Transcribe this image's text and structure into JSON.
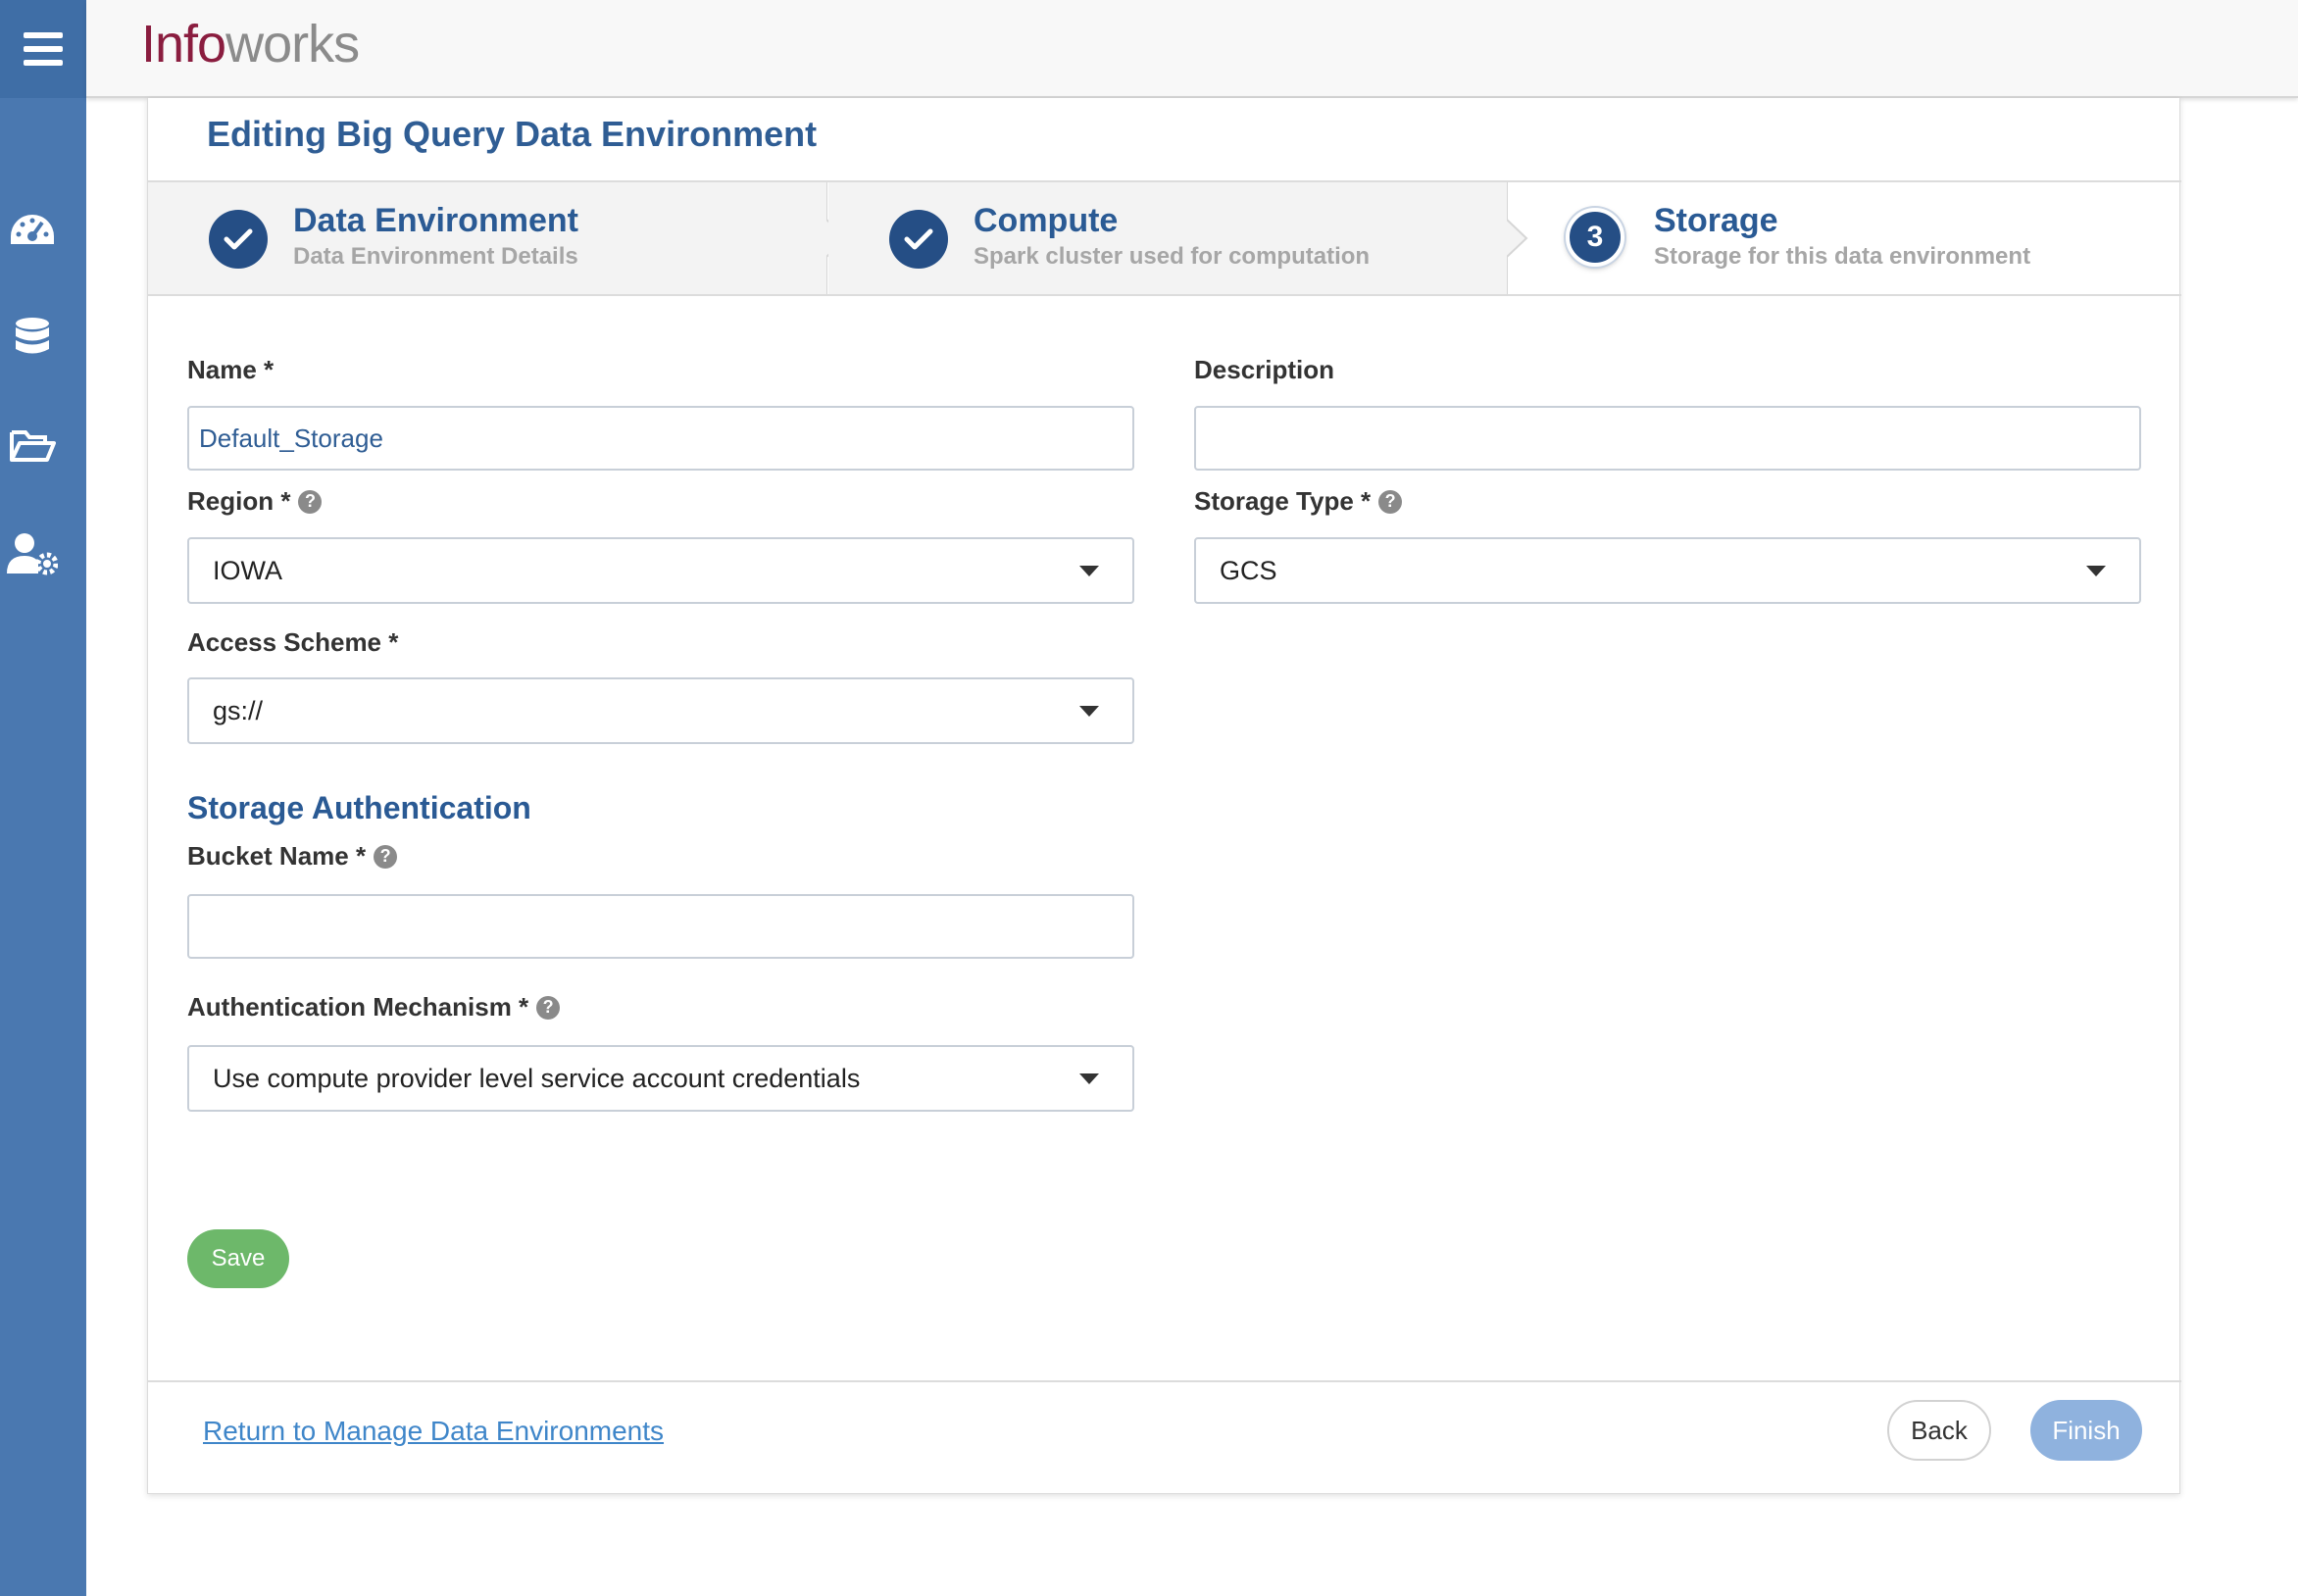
{
  "app": {
    "logo_part1": "Info",
    "logo_part2": "works"
  },
  "sidebar": {
    "items": [
      {
        "icon": "dashboard-icon"
      },
      {
        "icon": "database-icon"
      },
      {
        "icon": "folder-icon"
      },
      {
        "icon": "user-settings-icon"
      }
    ]
  },
  "page": {
    "title": "Editing Big Query Data Environment"
  },
  "steps": [
    {
      "title": "Data Environment",
      "subtitle": "Data Environment Details",
      "state": "done"
    },
    {
      "title": "Compute",
      "subtitle": "Spark cluster used for computation",
      "state": "done"
    },
    {
      "number": "3",
      "title": "Storage",
      "subtitle": "Storage for this data environment",
      "state": "active"
    }
  ],
  "form": {
    "name_label": "Name *",
    "name_value": "Default_Storage",
    "description_label": "Description",
    "description_value": "",
    "region_label": "Region *",
    "region_value": "IOWA",
    "storage_type_label": "Storage Type *",
    "storage_type_value": "GCS",
    "access_scheme_label": "Access Scheme *",
    "access_scheme_value": "gs://",
    "auth_section_title": "Storage Authentication",
    "bucket_label": "Bucket Name *",
    "bucket_value": "",
    "auth_mech_label": "Authentication Mechanism *",
    "auth_mech_value": "Use compute provider level service account credentials",
    "help_glyph": "?",
    "save_label": "Save"
  },
  "footer": {
    "return_link": "Return to Manage Data Environments",
    "back_label": "Back",
    "finish_label": "Finish"
  },
  "colors": {
    "sidebar": "#4a78b0",
    "brand_title": "#2a5a94",
    "step_circle": "#254e85",
    "save": "#6db86a",
    "finish": "#8fb2de",
    "logo_accent": "#8a1d3f"
  }
}
